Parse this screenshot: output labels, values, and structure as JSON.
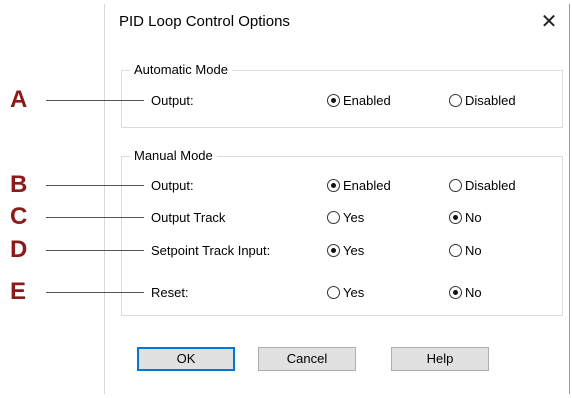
{
  "dialog": {
    "title": "PID Loop Control Options",
    "close_glyph": "✕"
  },
  "automatic_mode": {
    "legend": "Automatic Mode",
    "rows": [
      {
        "label": "Output:",
        "option1": "Enabled",
        "option2": "Disabled",
        "selected": 1
      }
    ]
  },
  "manual_mode": {
    "legend": "Manual Mode",
    "rows": [
      {
        "label": "Output:",
        "option1": "Enabled",
        "option2": "Disabled",
        "selected": 1
      },
      {
        "label": "Output Track",
        "option1": "Yes",
        "option2": "No",
        "selected": 2
      },
      {
        "label": "Setpoint Track Input:",
        "option1": "Yes",
        "option2": "No",
        "selected": 1
      },
      {
        "label": "Reset:",
        "option1": "Yes",
        "option2": "No",
        "selected": 2
      }
    ]
  },
  "buttons": {
    "ok": "OK",
    "cancel": "Cancel",
    "help": "Help"
  },
  "callouts": [
    "A",
    "B",
    "C",
    "D",
    "E"
  ],
  "colors": {
    "callout": "#8b1a1a",
    "default_button_border": "#0078d7"
  }
}
